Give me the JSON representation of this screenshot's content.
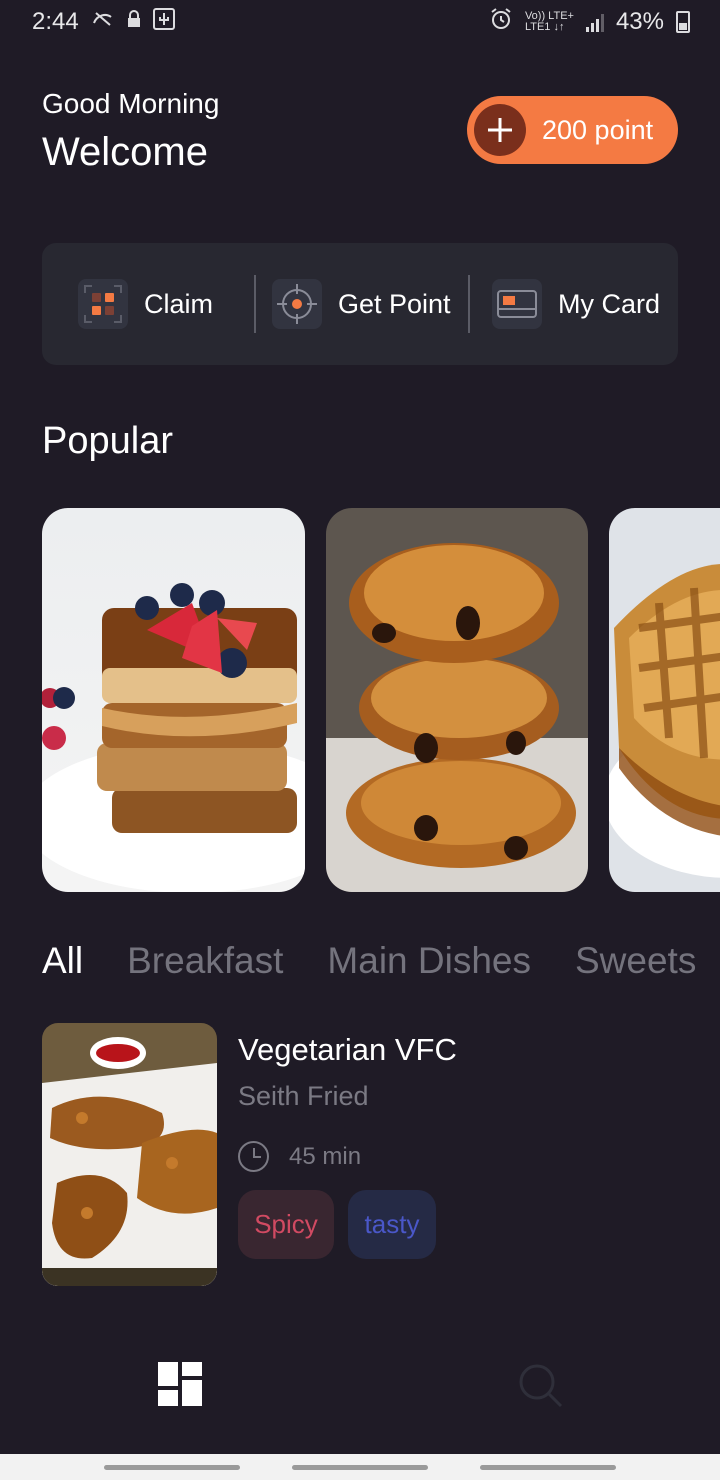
{
  "status_bar": {
    "time": "2:44",
    "network_top": "Vo)) LTE+",
    "network_bottom": "LTE1 ↓↑",
    "battery_percent": "43%",
    "icons": [
      "snooze-icon",
      "lock-icon",
      "usb-icon",
      "alarm-icon",
      "signal-icon",
      "battery-icon"
    ]
  },
  "header": {
    "greeting": "Good Morning",
    "welcome": "Welcome",
    "points_label": "200 point",
    "points_icon": "plus-icon"
  },
  "actions": [
    {
      "label": "Claim",
      "icon": "claim-icon"
    },
    {
      "label": "Get Point",
      "icon": "target-icon"
    },
    {
      "label": "My Card",
      "icon": "card-icon"
    }
  ],
  "popular": {
    "title": "Popular",
    "items": [
      {
        "image": "french-toast-image"
      },
      {
        "image": "pain-au-chocolat-image"
      },
      {
        "image": "waffle-image"
      }
    ]
  },
  "categories": {
    "items": [
      "All",
      "Breakfast",
      "Main Dishes",
      "Sweets"
    ],
    "active": "All"
  },
  "recipe": {
    "title": "Vegetarian VFC",
    "subtitle": "Seith Fried",
    "time": "45 min",
    "tags": [
      {
        "label": "Spicy",
        "color": "#d14a62"
      },
      {
        "label": "tasty",
        "color": "#4a57c8"
      }
    ]
  },
  "bottom_nav": {
    "items": [
      "dashboard-icon",
      "search-icon"
    ]
  },
  "colors": {
    "background": "#1f1b26",
    "accent": "#f47a43",
    "panel": "#282831",
    "muted_text": "#74737d"
  }
}
